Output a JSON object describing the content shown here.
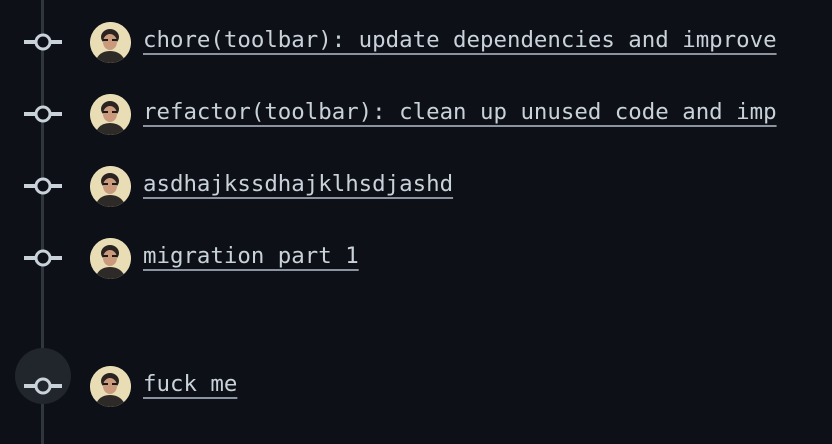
{
  "commits": [
    {
      "title": "chore(toolbar): update dependencies and improve",
      "icon": "git-commit-icon",
      "avatar": "user-avatar"
    },
    {
      "title": "refactor(toolbar): clean up unused code and imp",
      "icon": "git-commit-icon",
      "avatar": "user-avatar"
    },
    {
      "title": "asdhajkssdhajklhsdjashd",
      "icon": "git-commit-icon",
      "avatar": "user-avatar"
    },
    {
      "title": "migration part 1",
      "icon": "git-commit-icon",
      "avatar": "user-avatar"
    },
    {
      "title": "fuck me",
      "icon": "git-commit-icon",
      "avatar": "user-avatar"
    }
  ],
  "colors": {
    "background": "#0d1117",
    "timeline": "#30363d",
    "text": "#c9d1d9",
    "underline": "#8b949e",
    "highlight_circle": "#21262d"
  }
}
